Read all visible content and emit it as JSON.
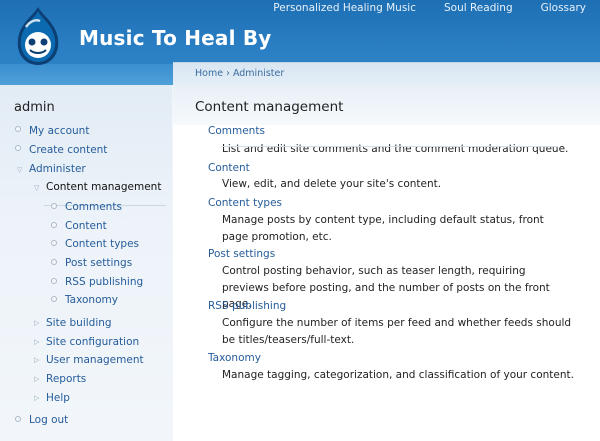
{
  "site": {
    "name": "Music To Heal By"
  },
  "primary_links": [
    {
      "label": "Personalized Healing Music"
    },
    {
      "label": "Soul Reading"
    },
    {
      "label": "Glossary"
    }
  ],
  "sidebar": {
    "title": "admin",
    "items": [
      {
        "label": "My account"
      },
      {
        "label": "Create content"
      },
      {
        "label": "Administer"
      },
      {
        "label": "Content management"
      },
      {
        "label": "Comments"
      },
      {
        "label": "Content"
      },
      {
        "label": "Content types"
      },
      {
        "label": "Post settings"
      },
      {
        "label": "RSS publishing"
      },
      {
        "label": "Taxonomy"
      },
      {
        "label": "Site building"
      },
      {
        "label": "Site configuration"
      },
      {
        "label": "User management"
      },
      {
        "label": "Reports"
      },
      {
        "label": "Help"
      },
      {
        "label": "Log out"
      }
    ]
  },
  "breadcrumb": {
    "home": "Home",
    "separator": "›",
    "current": "Administer"
  },
  "main": {
    "title": "Content management",
    "items": [
      {
        "title": "Comments",
        "desc": "List and edit site comments and the comment moderation queue."
      },
      {
        "title": "Content",
        "desc": "View, edit, and delete your site's content."
      },
      {
        "title": "Content types",
        "desc": "Manage posts by content type, including default status, front page promotion, etc."
      },
      {
        "title": "Post settings",
        "desc": "Control posting behavior, such as teaser length, requiring previews before posting, and the number of posts on the front page."
      },
      {
        "title": "RSS publishing",
        "desc": "Configure the number of items per feed and whether feeds should be titles/teasers/full-text."
      },
      {
        "title": "Taxonomy",
        "desc": "Manage tagging, categorization, and classification of your content."
      }
    ]
  },
  "colors": {
    "header": "#2a7ec3",
    "link": "#255c9a",
    "sidebar_bg": "#e2ecf5"
  }
}
